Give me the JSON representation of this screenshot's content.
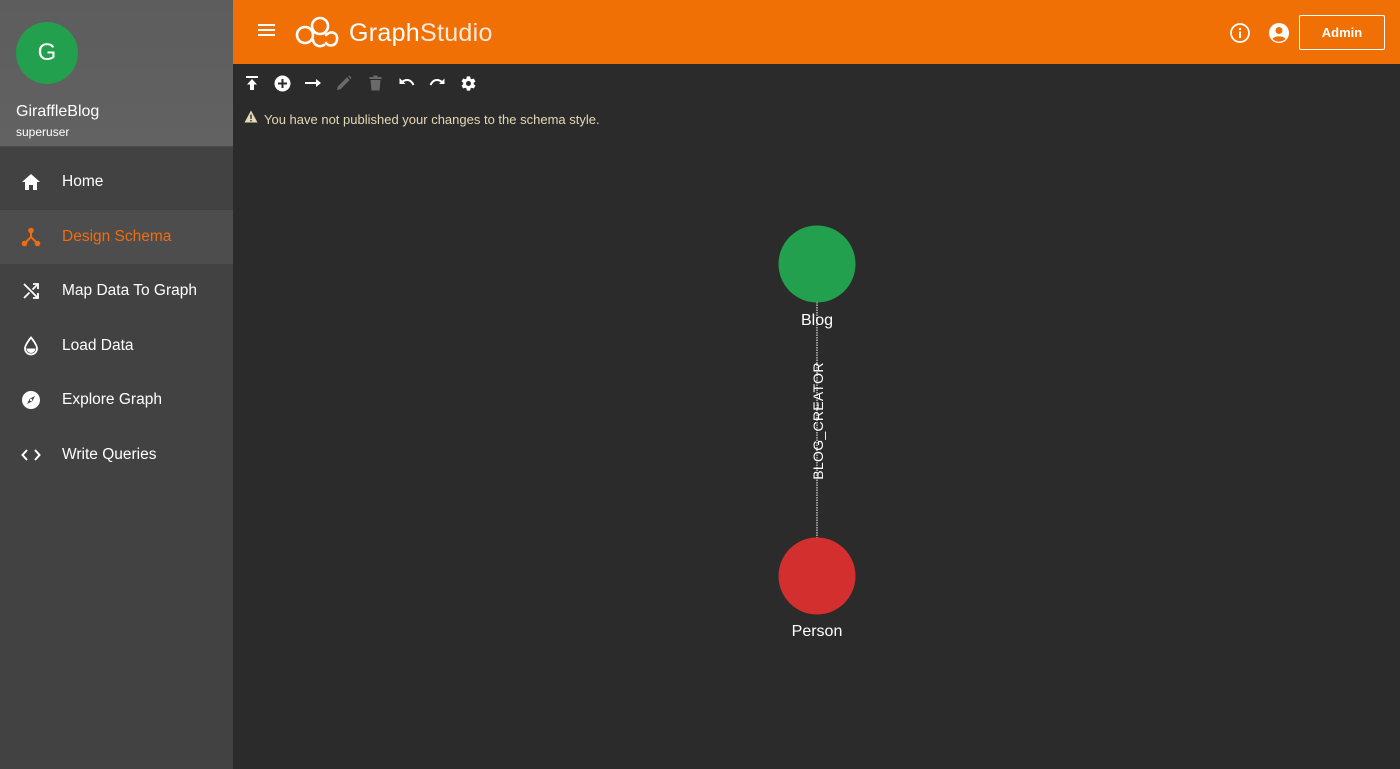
{
  "app": {
    "logo_text_bold": "Graph",
    "logo_text_light": "Studio",
    "admin_label": "Admin"
  },
  "user": {
    "avatar_letter": "G",
    "graph_name": "GiraffleBlog",
    "role": "superuser"
  },
  "nav": {
    "items": [
      {
        "label": "Home",
        "icon": "home-icon"
      },
      {
        "label": "Design Schema",
        "icon": "schema-icon",
        "active": true
      },
      {
        "label": "Map Data To Graph",
        "icon": "shuffle-icon"
      },
      {
        "label": "Load Data",
        "icon": "drop-icon"
      },
      {
        "label": "Explore Graph",
        "icon": "compass-icon"
      },
      {
        "label": "Write Queries",
        "icon": "code-icon"
      }
    ]
  },
  "toolbar": {
    "buttons": [
      "publish-icon",
      "add-vertex-icon",
      "add-edge-icon",
      "edit-icon",
      "delete-icon",
      "undo-icon",
      "redo-icon",
      "settings-icon"
    ]
  },
  "warning": {
    "text": "You have not published your changes to the schema style."
  },
  "schema": {
    "vertices": [
      {
        "label": "Blog",
        "color": "#22a04e"
      },
      {
        "label": "Person",
        "color": "#d32f2f"
      }
    ],
    "edges": [
      {
        "label": "BLOG_CREATOR",
        "from": "Blog",
        "to": "Person"
      }
    ]
  },
  "colors": {
    "accent": "#f07006",
    "active_nav": "#f06d0f",
    "canvas": "#2b2b2b",
    "sidebar": "#424242"
  }
}
